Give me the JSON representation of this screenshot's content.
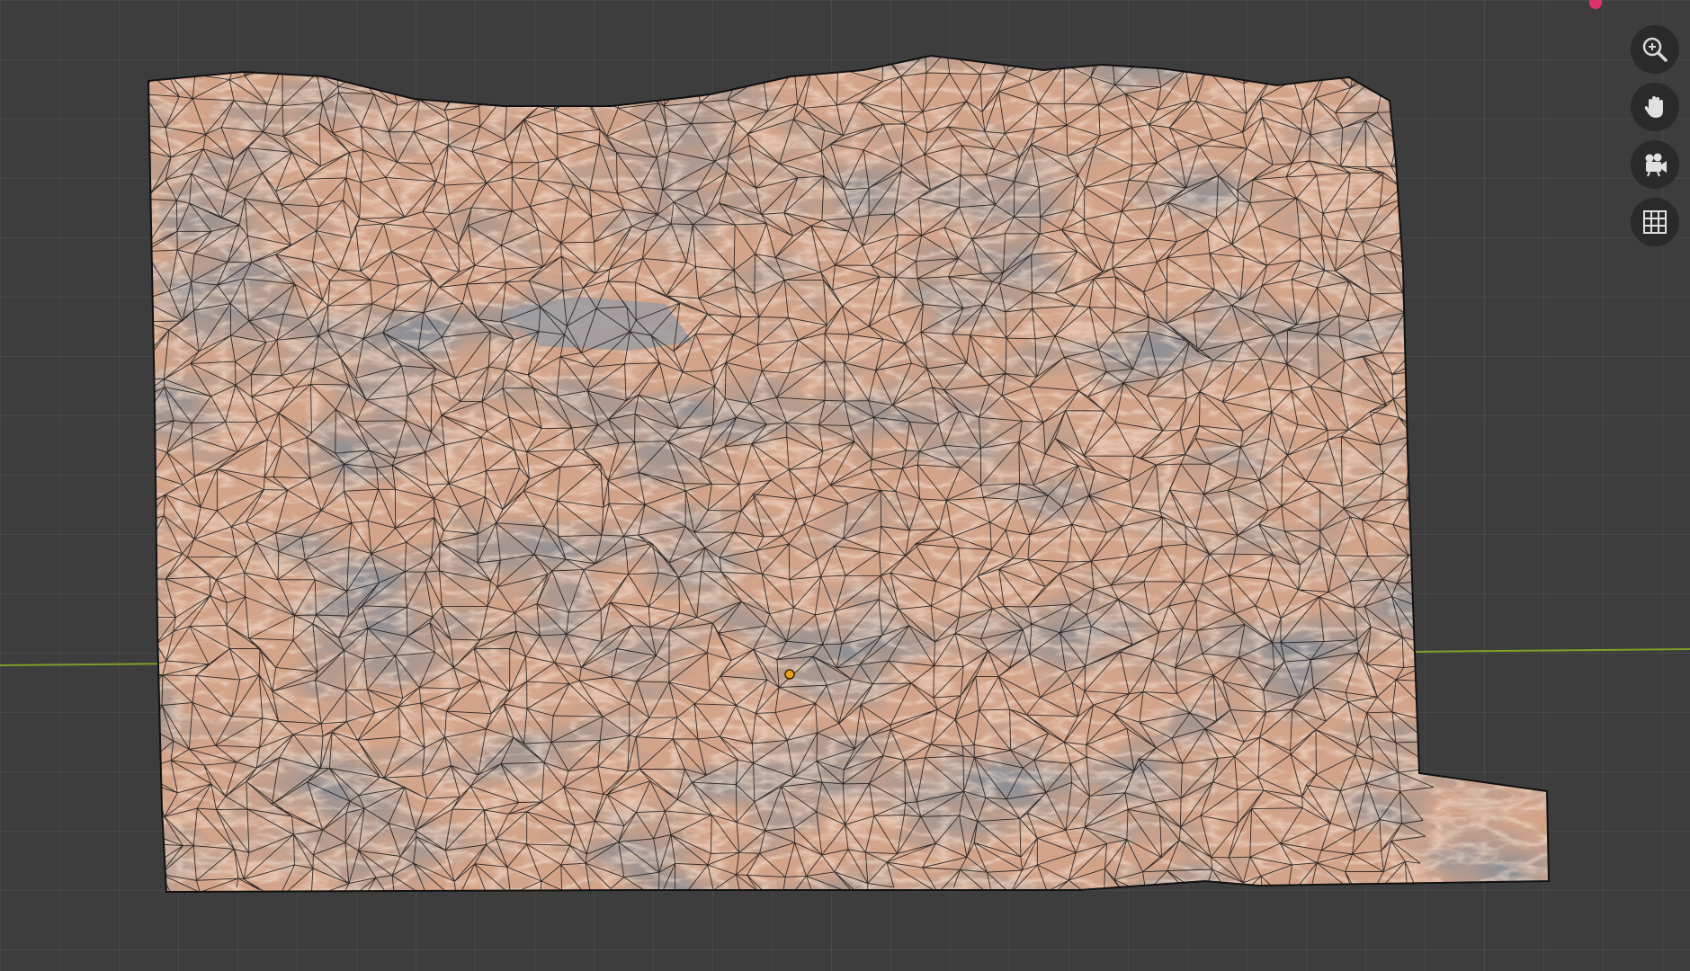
{
  "viewport": {
    "background_color": "#3d3d3d",
    "grid_color": "#4a4a4a",
    "x_axis_color": "#7fa02a",
    "mesh": {
      "object": "terrain-mesh",
      "texture_tones": [
        "#d9a88c",
        "#c49279",
        "#6e6c70",
        "#48474c",
        "#9a9aa0"
      ],
      "wire_color": "#151515",
      "base_color": "#8c8c8c",
      "origin_color": "#e8a21a"
    }
  },
  "navigation_gizmo": {
    "buttons": [
      {
        "icon": "zoom-icon",
        "tooltip": ""
      },
      {
        "icon": "hand-icon",
        "tooltip": ""
      },
      {
        "icon": "camera-icon",
        "tooltip": ""
      },
      {
        "icon": "grid-icon",
        "tooltip": ""
      }
    ],
    "accent_color": "#e0306e"
  }
}
